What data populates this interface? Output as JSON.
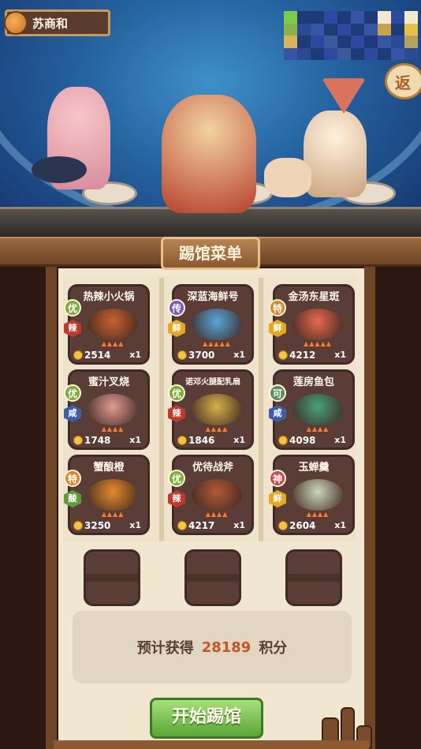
{
  "player": {
    "name": "苏商和"
  },
  "back_button": {
    "label": "返"
  },
  "board": {
    "title": "踢馆菜单"
  },
  "colors": {
    "grade_you": "#7cab3a",
    "grade_chuan": "#7a5bb0",
    "grade_te": "#d9852a",
    "grade_ke": "#5f8c5b",
    "grade_shen": "#c84c4c",
    "flavor_la": "#c0392b",
    "flavor_xian": "#e6a91e",
    "flavor_xian2": "#3c5fa8",
    "flavor_suan": "#5f9c3a"
  },
  "dishes": [
    {
      "name": "热辣小火锅",
      "grade": "优",
      "flavor": "辣",
      "price": "2514",
      "qty": "x1",
      "flames": 4,
      "food_color": "#c8622f"
    },
    {
      "name": "深蓝海鲜号",
      "grade": "传",
      "flavor": "鲜",
      "price": "3700",
      "qty": "x1",
      "flames": 5,
      "food_color": "#5aa6d8"
    },
    {
      "name": "金汤东星斑",
      "grade": "特",
      "flavor": "鲜",
      "price": "4212",
      "qty": "x1",
      "flames": 5,
      "food_color": "#e56a4d"
    },
    {
      "name": "蜜汁叉烧",
      "grade": "优",
      "flavor": "咸",
      "price": "1748",
      "qty": "x1",
      "flames": 4,
      "food_color": "#e29a92"
    },
    {
      "name": "诺邓火腿配乳扇",
      "grade": "优",
      "flavor": "辣",
      "price": "1846",
      "qty": "x1",
      "flames": 4,
      "food_color": "#d8b04a"
    },
    {
      "name": "莲房鱼包",
      "grade": "可",
      "flavor": "咸",
      "price": "4098",
      "qty": "x1",
      "flames": 4,
      "food_color": "#4aa07a"
    },
    {
      "name": "蟹酿橙",
      "grade": "特",
      "flavor": "酸",
      "price": "3250",
      "qty": "x1",
      "flames": 4,
      "food_color": "#e38a2b"
    },
    {
      "name": "优待战斧",
      "grade": "优",
      "flavor": "辣",
      "price": "4217",
      "qty": "x1",
      "flames": 4,
      "food_color": "#b25a35"
    },
    {
      "name": "玉蝉羹",
      "grade": "神",
      "flavor": "鲜",
      "price": "2604",
      "qty": "x1",
      "flames": 4,
      "food_color": "#cfd6b8"
    }
  ],
  "reward": {
    "prefix": "预计获得",
    "points": "28189",
    "suffix": "积分"
  },
  "start_button": {
    "label": "开始踢馆"
  }
}
